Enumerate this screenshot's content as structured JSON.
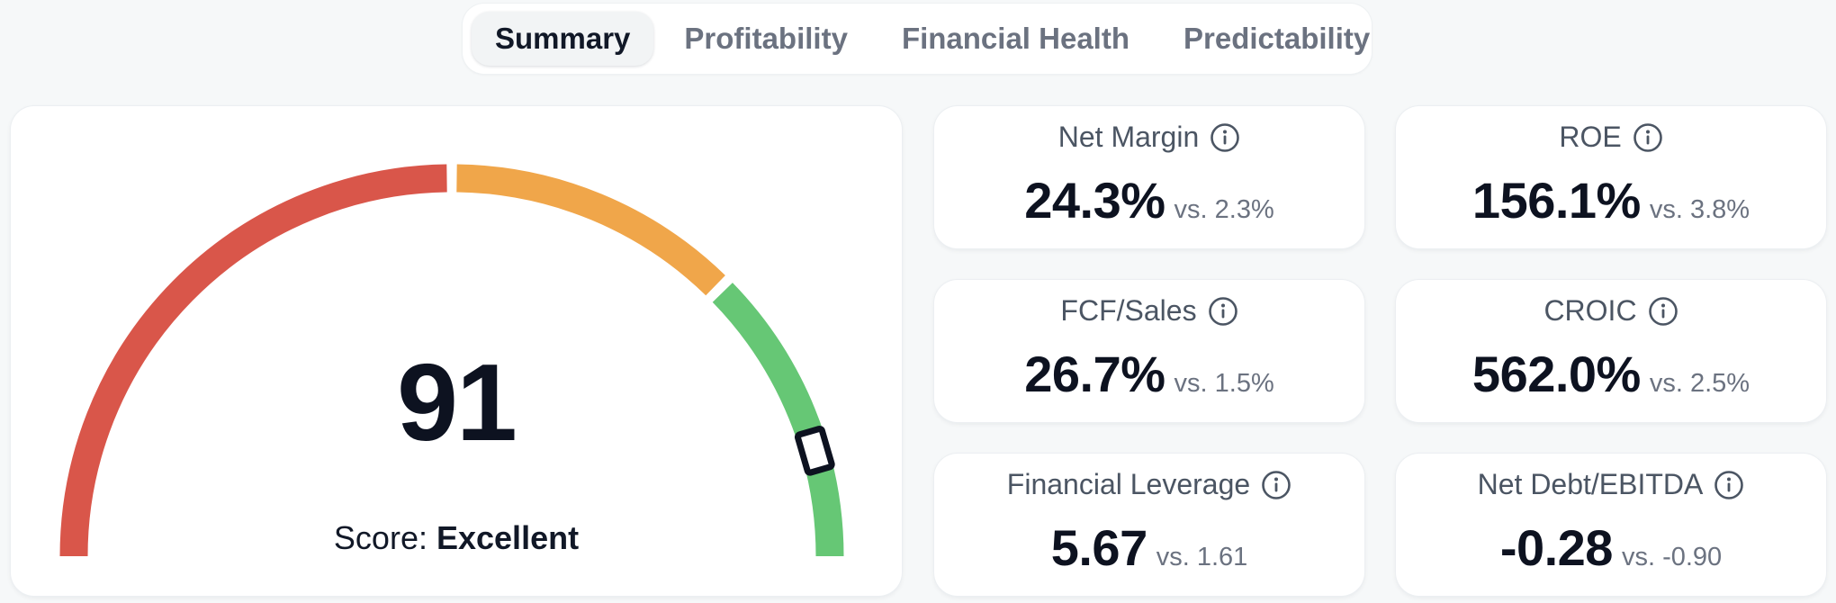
{
  "tabs": [
    {
      "label": "Summary",
      "active": true
    },
    {
      "label": "Profitability",
      "active": false
    },
    {
      "label": "Financial Health",
      "active": false
    },
    {
      "label": "Predictability",
      "active": false
    }
  ],
  "gauge": {
    "score": "91",
    "score_value": 91,
    "score_prefix": "Score:",
    "rating": "Excellent",
    "colors": {
      "poor": "#d9564a",
      "fair": "#f0a64a",
      "excellent": "#66c775"
    }
  },
  "metrics": [
    {
      "title": "Net Margin",
      "value": "24.3%",
      "compare": "vs. 2.3%"
    },
    {
      "title": "ROE",
      "value": "156.1%",
      "compare": "vs. 3.8%"
    },
    {
      "title": "FCF/Sales",
      "value": "26.7%",
      "compare": "vs. 1.5%"
    },
    {
      "title": "CROIC",
      "value": "562.0%",
      "compare": "vs. 2.5%"
    },
    {
      "title": "Financial Leverage",
      "value": "5.67",
      "compare": "vs. 1.61"
    },
    {
      "title": "Net Debt/EBITDA",
      "value": "-0.28",
      "compare": "vs. -0.90"
    }
  ],
  "icons": {
    "info": "info-icon"
  }
}
